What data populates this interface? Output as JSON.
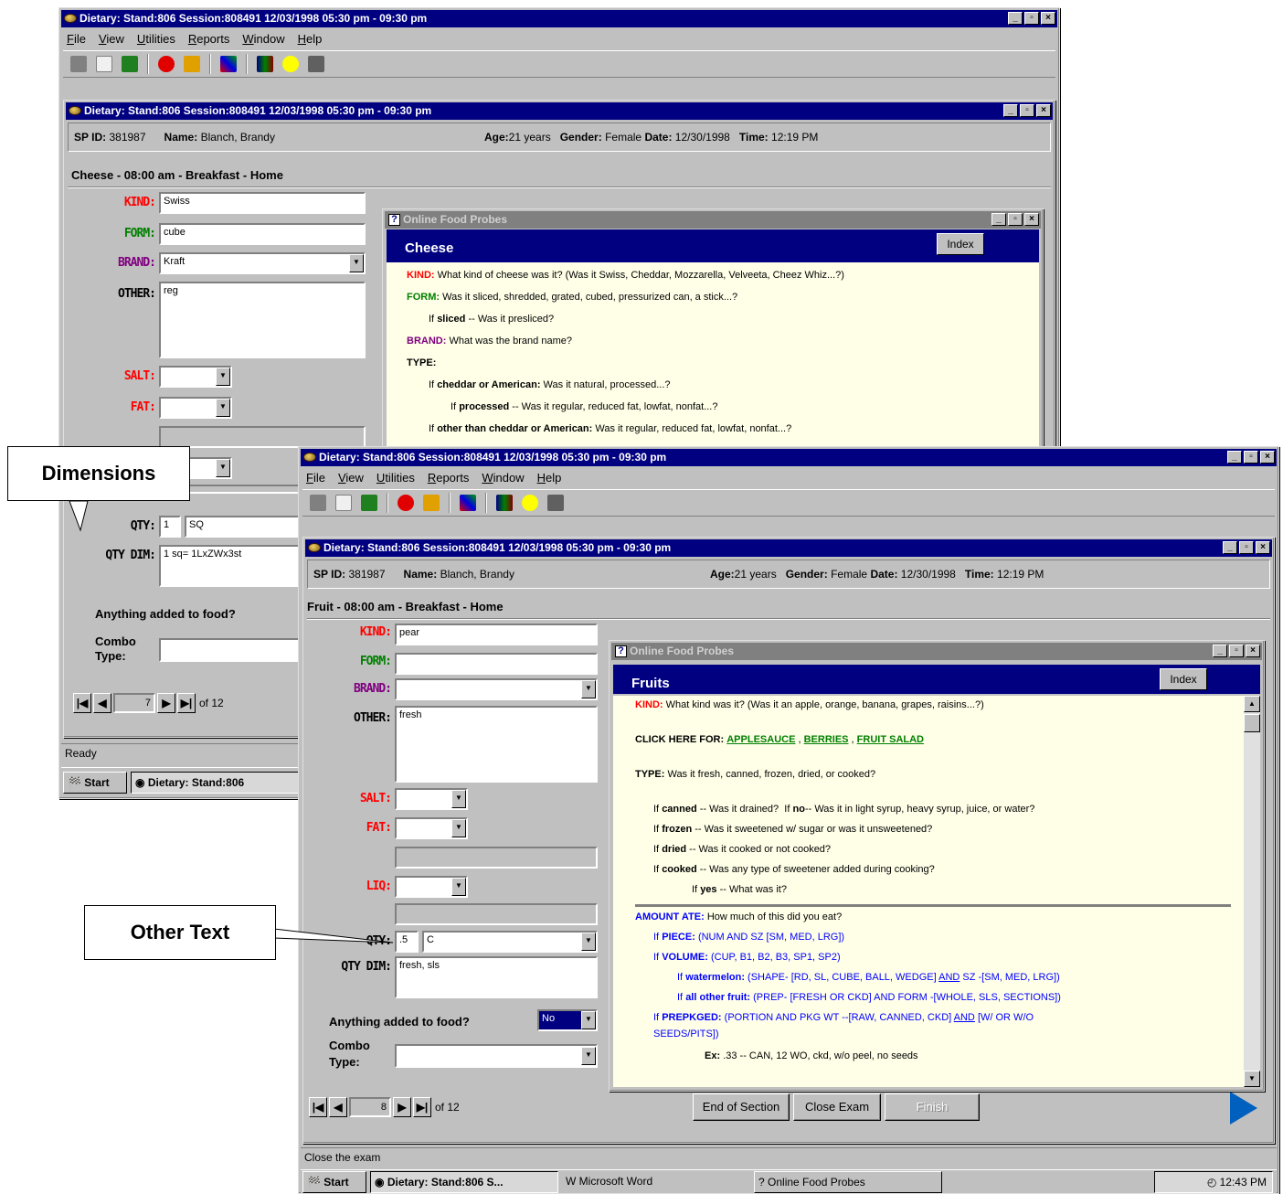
{
  "back": {
    "title": "Dietary: Stand:806 Session:808491 12/03/1998 05:30 pm - 09:30 pm",
    "menu": [
      "File",
      "View",
      "Utilities",
      "Reports",
      "Window",
      "Help"
    ],
    "inner_title": "Dietary: Stand:806 Session:808491 12/03/1998 05:30 pm - 09:30 pm",
    "info": {
      "sp_label": "SP ID:",
      "sp_id": "381987",
      "name_label": "Name:",
      "name": "Blanch, Brandy",
      "age_label": "Age:",
      "age": "21 years",
      "gender_label": "Gender:",
      "gender": "Female",
      "date_label": "Date:",
      "date": "12/30/1998",
      "time_label": "Time:",
      "time": "12:19 PM"
    },
    "section": "Cheese - 08:00 am - Breakfast - Home",
    "kind_label": "KIND:",
    "kind": "Swiss",
    "form_label": "FORM:",
    "form": "cube",
    "brand_label": "BRAND:",
    "brand": "Kraft",
    "other_label": "OTHER:",
    "other": "reg",
    "salt_label": "SALT:",
    "fat_label": "FAT:",
    "qty_label": "QTY:",
    "qty": "1",
    "qty_unit": "SQ",
    "qtydim_label": "QTY DIM:",
    "qtydim": "1 sq= 1LxZWx3st",
    "anything": "Anything added to food?",
    "combo": "Combo",
    "type": "Type:",
    "nav_num": "7",
    "nav_of": "of 12",
    "status": "Ready",
    "task_start": "Start",
    "task_dietary": "Dietary: Stand:806",
    "probe": {
      "title": "Online Food Probes",
      "heading": "Cheese",
      "index": "Index",
      "l1_tag": "KIND:",
      "l1": "What kind of cheese was it?  (Was it Swiss, Cheddar, Mozzarella, Velveeta, Cheez Whiz...?)",
      "l2_tag": "FORM:",
      "l2": "Was it sliced, shredded, grated, cubed, pressurized can, a stick...?",
      "l3_if": "If",
      "l3_b": "sliced",
      "l3": "-- Was it presliced?",
      "l4_tag": "BRAND:",
      "l4": "What was the brand name?",
      "l5": "TYPE:",
      "l6_if": "If",
      "l6_b": "cheddar or American:",
      "l6": "Was it natural, processed...?",
      "l7_if": "If",
      "l7_b": "processed",
      "l7": "-- Was it regular, reduced fat, lowfat, nonfat...?",
      "l8_if": "If",
      "l8_b": "other than cheddar or American:",
      "l8": "Was it regular, reduced fat, lowfat, nonfat...?"
    }
  },
  "front": {
    "title": "Dietary: Stand:806 Session:808491 12/03/1998 05:30 pm - 09:30 pm",
    "menu": [
      "File",
      "View",
      "Utilities",
      "Reports",
      "Window",
      "Help"
    ],
    "inner_title": "Dietary: Stand:806 Session:808491 12/03/1998 05:30 pm - 09:30 pm",
    "info": {
      "sp_label": "SP ID:",
      "sp_id": "381987",
      "name_label": "Name:",
      "name": "Blanch, Brandy",
      "age_label": "Age:",
      "age": "21 years",
      "gender_label": "Gender:",
      "gender": "Female",
      "date_label": "Date:",
      "date": "12/30/1998",
      "time_label": "Time:",
      "time": "12:19 PM"
    },
    "section": "Fruit - 08:00 am - Breakfast - Home",
    "kind_label": "KIND:",
    "kind": "pear",
    "form_label": "FORM:",
    "form": "",
    "brand_label": "BRAND:",
    "brand": "",
    "other_label": "OTHER:",
    "other": "fresh",
    "salt_label": "SALT:",
    "fat_label": "FAT:",
    "liq_label": "LIQ:",
    "qty_label": "QTY:",
    "qty": ".5",
    "qty_unit": "C",
    "qtydim_label": "QTY DIM:",
    "qtydim": "fresh, sls",
    "anything": "Anything added to food?",
    "anything_val": "No",
    "combo": "Combo",
    "type": "Type:",
    "nav_num": "8",
    "nav_of": "of 12",
    "btn_end": "End of Section",
    "btn_close": "Close Exam",
    "btn_finish": "Finish",
    "status": "Close the exam",
    "task_start": "Start",
    "task_dietary": "Dietary: Stand:806 S...",
    "task_word": "Microsoft Word",
    "task_probes": "Online Food Probes",
    "clock": "12:43 PM",
    "probe": {
      "title": "Online Food Probes",
      "heading": "Fruits",
      "index": "Index",
      "kind_tag": "KIND:",
      "kind": "What kind was it?  (Was it an apple, orange, banana, grapes, raisins...?)",
      "click": "CLICK HERE FOR:",
      "link1": "APPLESAUCE",
      "link2": "BERRIES",
      "link3": "FRUIT SALAD",
      "type_tag": "TYPE:",
      "type": "Was it fresh, canned, frozen, dried, or cooked?",
      "c_if": "If",
      "c_b": "canned",
      "c": "-- Was it drained?",
      "c2_if": "If",
      "c2_b": "no",
      "c2": "-- Was it in light syrup, heavy syrup, juice, or water?",
      "f_if": "If",
      "f_b": "frozen",
      "f": "-- Was it sweetened w/ sugar or was it unsweetened?",
      "d_if": "If",
      "d_b": "dried",
      "d": "-- Was it cooked or not cooked?",
      "k_if": "If",
      "k_b": "cooked",
      "k": "-- Was any type of sweetener added during cooking?",
      "y_if": "If",
      "y_b": "yes",
      "y": "-- What was it?",
      "amt_tag": "AMOUNT ATE:",
      "amt": "How much of this did you eat?",
      "pc_if": "If",
      "pc_b": "PIECE:",
      "pc": "(NUM AND SZ [SM, MED, LRG])",
      "vol_if": "If",
      "vol_b": "VOLUME:",
      "vol": "(CUP, B1, B2, B3, SP1, SP2)",
      "wm_if": "If",
      "wm_b": "watermelon:",
      "wm": "(SHAPE- [RD, SL, CUBE, BALL, WEDGE]",
      "wm_and": "AND",
      "wm2": "SZ -[SM, MED, LRG])",
      "ao_if": "If",
      "ao_b": "all other fruit:",
      "ao": "(PREP- [FRESH OR CKD] AND FORM -[WHOLE, SLS, SECTIONS])",
      "pp_if": "If",
      "pp_b": "PREPKGED:",
      "pp": "(PORTION AND PKG WT --[RAW, CANNED, CKD]",
      "pp_and": "AND",
      "pp2": "[W/ OR W/O",
      "pp3": "SEEDS/PITS])",
      "ex_tag": "Ex:",
      "ex": ".33 -- CAN, 12 WO, ckd, w/o peel, no seeds"
    }
  },
  "callouts": {
    "dimensions": "Dimensions",
    "other_text": "Other Text"
  }
}
